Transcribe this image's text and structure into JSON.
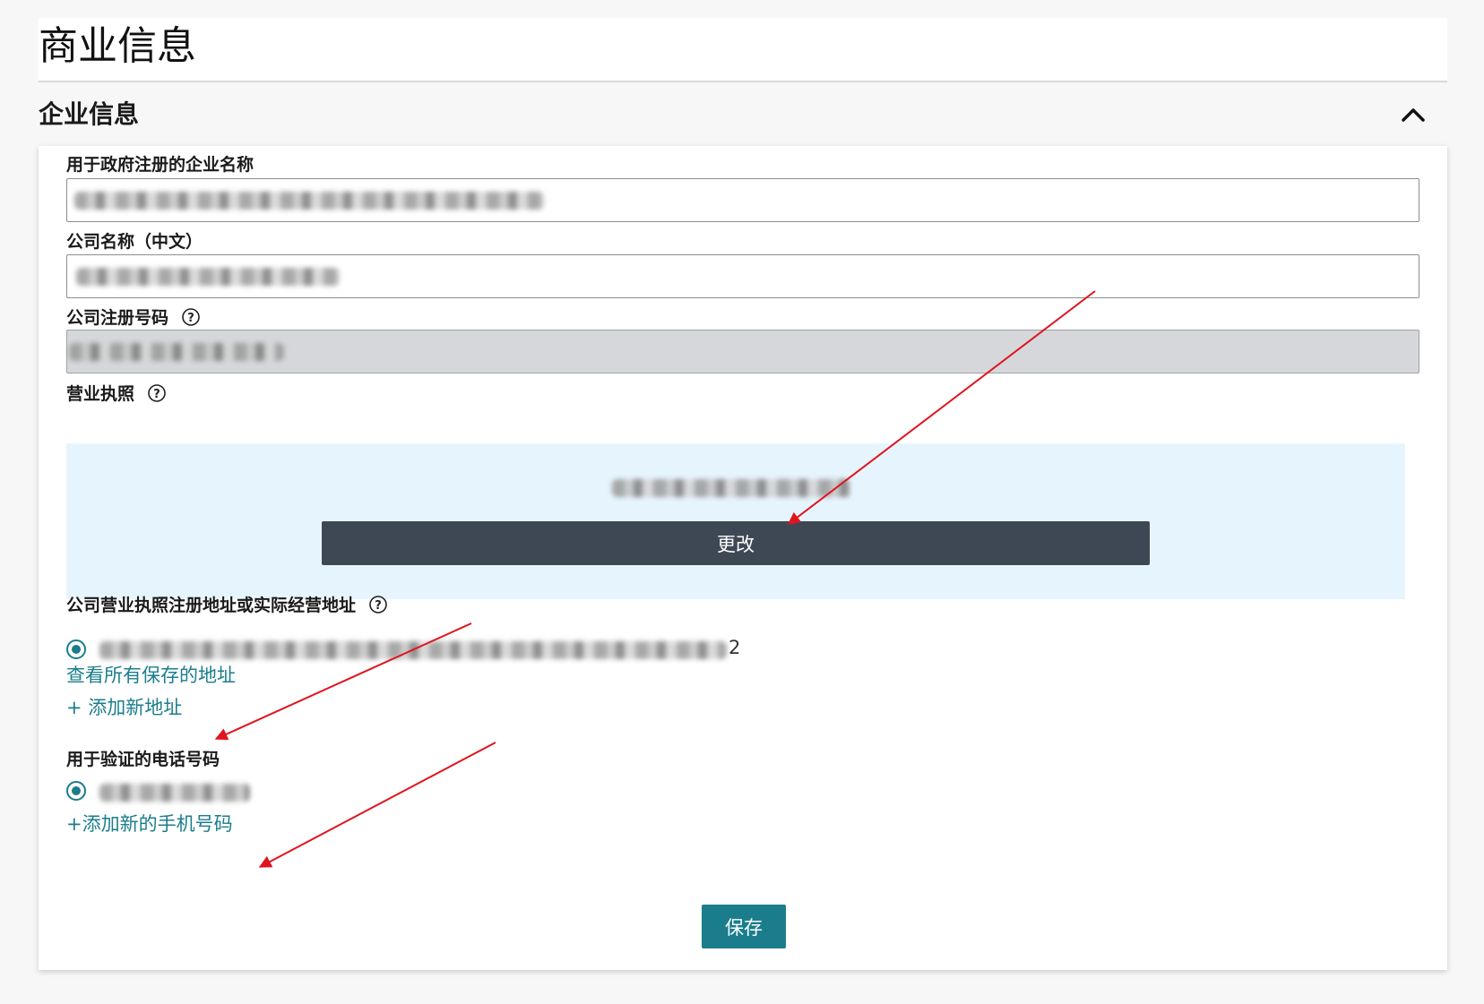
{
  "page": {
    "title": "商业信息"
  },
  "section": {
    "title": "企业信息",
    "collapse_icon": "chevron-up-icon"
  },
  "fields": {
    "gov_name": {
      "label": "用于政府注册的企业名称",
      "value": ""
    },
    "cn_name": {
      "label": "公司名称（中文）",
      "value": ""
    },
    "reg_number": {
      "label": "公司注册号码",
      "value": "",
      "help_icon": "help-circle-icon"
    },
    "license": {
      "label": "营业执照",
      "help_icon": "help-circle-icon",
      "change_label": "更改"
    },
    "address": {
      "label": "公司营业执照注册地址或实际经营地址",
      "help_icon": "help-circle-icon",
      "visible_suffix": "2",
      "view_all": "查看所有保存的地址",
      "add_new": "+ 添加新地址"
    },
    "phone": {
      "label": "用于验证的电话号码",
      "add_new": "+添加新的手机号码"
    }
  },
  "actions": {
    "save_label": "保存"
  },
  "colors": {
    "accent": "#1b7d8c",
    "dark_button": "#3e4855",
    "annotation": "#e0141e",
    "upload_bg": "#e6f5fd"
  }
}
